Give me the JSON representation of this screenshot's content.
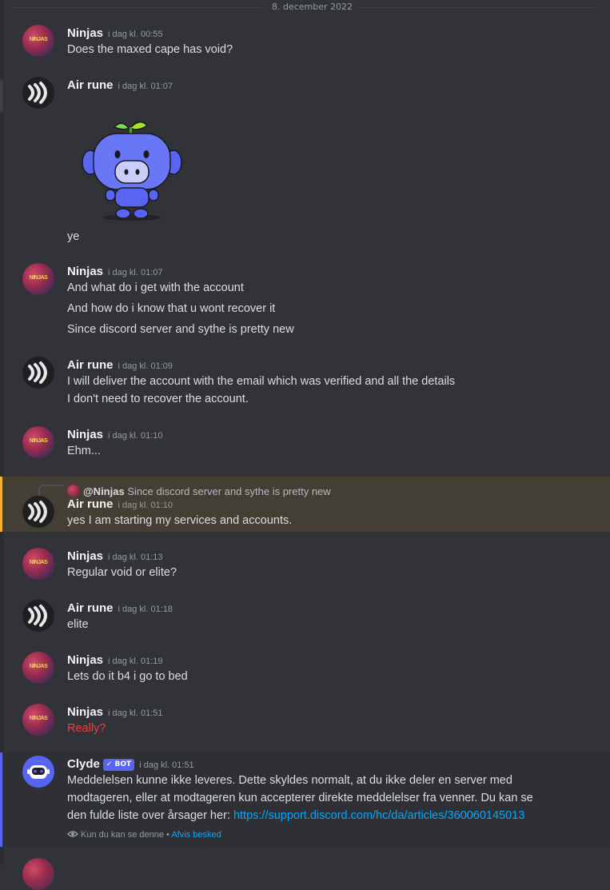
{
  "date_divider": "8. december 2022",
  "messages": [
    {
      "author": "Ninjas",
      "time": "i dag kl. 00:55",
      "lines": [
        "Does the maxed cape has void?"
      ]
    },
    {
      "author": "Air rune",
      "time": "i dag kl. 01:07",
      "lines": [
        "ye"
      ]
    },
    {
      "author": "Ninjas",
      "time": "i dag kl. 01:07",
      "lines": [
        "And what do i get with the account",
        "And how do i know that u wont recover it",
        "Since discord server and sythe is pretty new"
      ]
    },
    {
      "author": "Air rune",
      "time": "i dag kl. 01:09",
      "lines": [
        "I will deliver the account with the email which was verified and all the details",
        "I don't need to recover the account."
      ]
    },
    {
      "author": "Ninjas",
      "time": "i dag kl. 01:10",
      "lines": [
        "Ehm..."
      ]
    },
    {
      "author": "Air rune",
      "time": "i dag kl. 01:10",
      "lines": [
        "yes  I am starting my services and accounts."
      ],
      "reply": {
        "mention": "@Ninjas",
        "text": "Since discord server and sythe is pretty new"
      }
    },
    {
      "author": "Ninjas",
      "time": "i dag kl. 01:13",
      "lines": [
        "Regular void or elite?"
      ]
    },
    {
      "author": "Air rune",
      "time": "i dag kl. 01:18",
      "lines": [
        "elite"
      ]
    },
    {
      "author": "Ninjas",
      "time": "i dag kl. 01:19",
      "lines": [
        "Lets do it b4 i go to bed"
      ]
    },
    {
      "author": "Ninjas",
      "time": "i dag kl. 01:51",
      "lines": [
        "Really?"
      ]
    },
    {
      "author": "Clyde",
      "time": "i dag kl. 01:51",
      "badge": "✓ BOT",
      "lines": [
        "Meddelelsen kunne ikke leveres. Dette skyldes normalt, at du ikke deler en server med",
        "modtageren, eller at modtageren kun accepterer direkte meddelelser fra venner. Du kan se",
        "den fulde liste over årsager her: "
      ],
      "link": "https://support.discord.com/hc/da/articles/360060145013",
      "ephemeral": "Kun du kan se denne •",
      "dismiss": "Afvis besked"
    }
  ],
  "avatar_text": "NINJAS",
  "colors": {
    "background": "#313338",
    "text": "#dbdee1",
    "accent": "#5865f2",
    "mention_highlight": "#f0b232",
    "error": "#f23f43",
    "link": "#00a8fc"
  }
}
